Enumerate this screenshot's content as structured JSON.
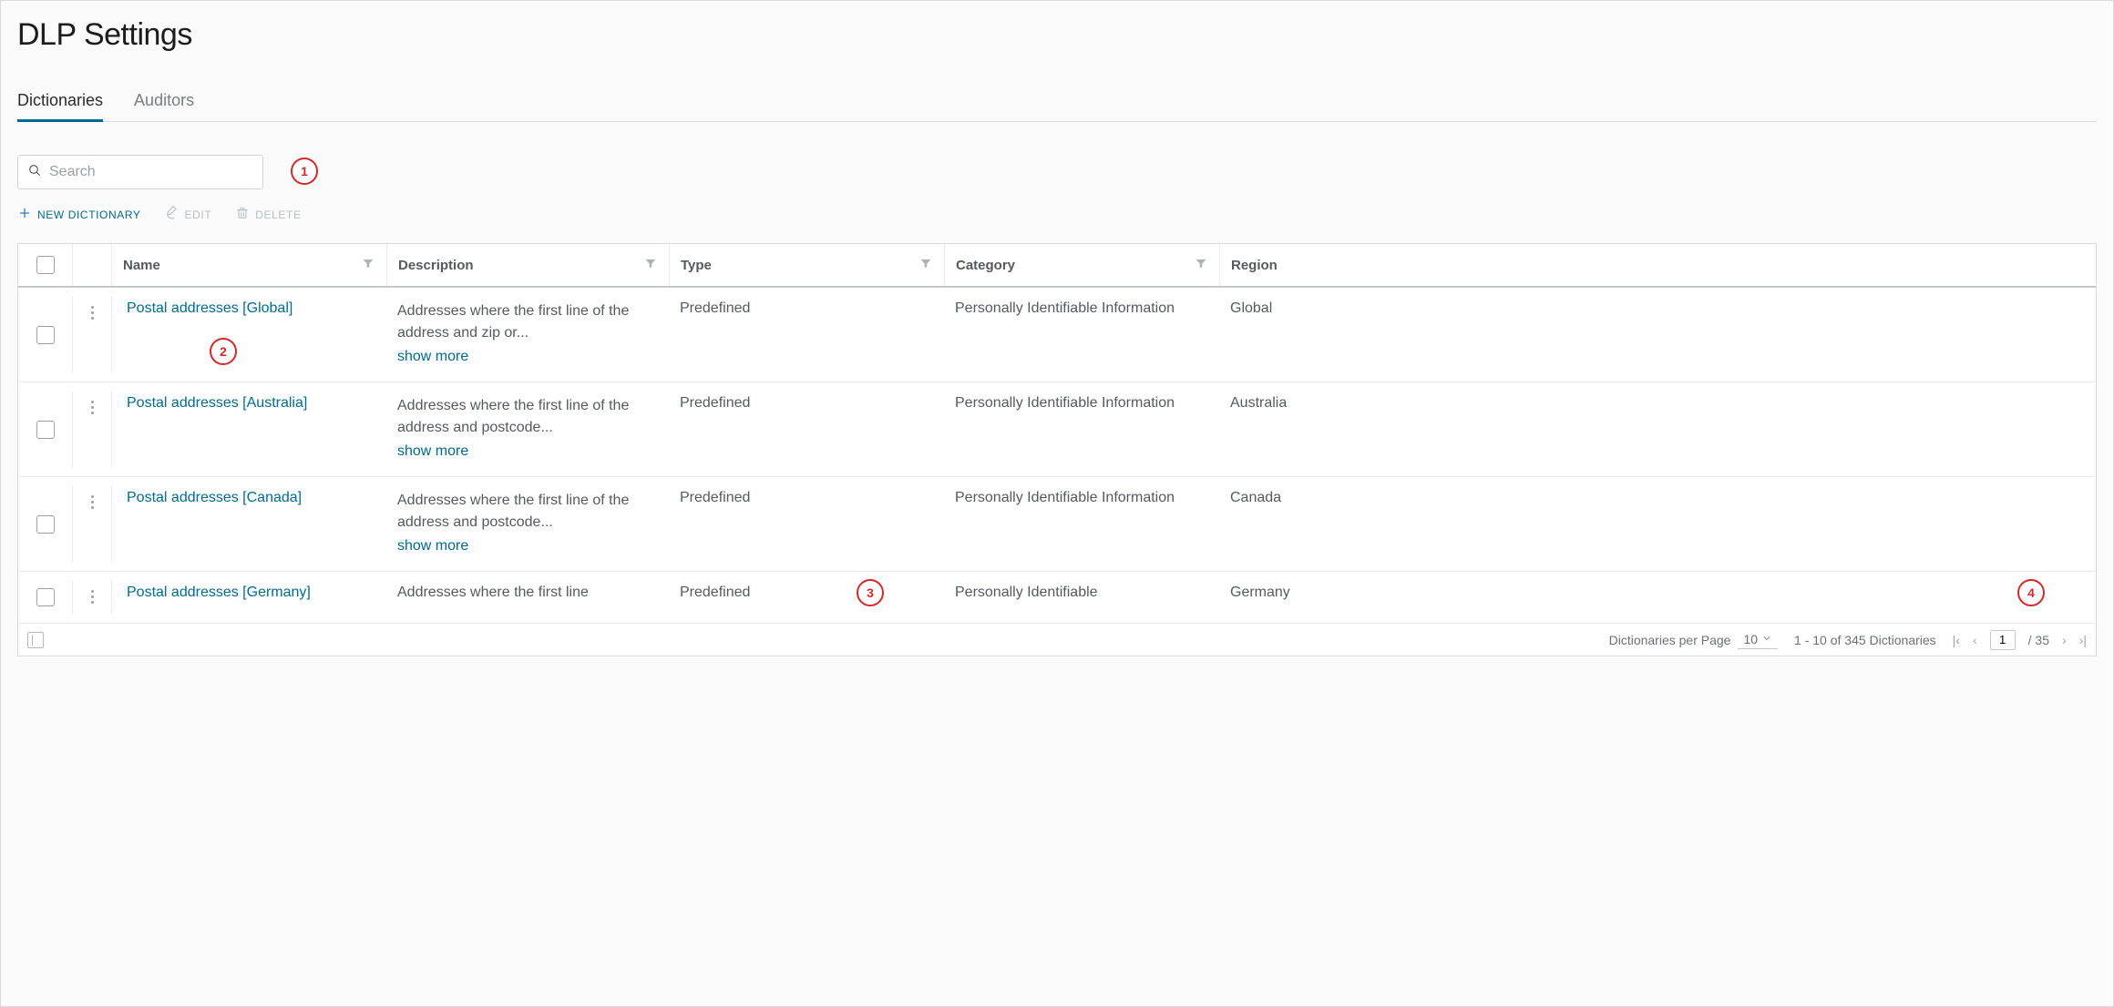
{
  "page_title": "DLP Settings",
  "tabs": [
    {
      "label": "Dictionaries",
      "active": true
    },
    {
      "label": "Auditors",
      "active": false
    }
  ],
  "search": {
    "placeholder": "Search"
  },
  "actions": {
    "new_label": "NEW DICTIONARY",
    "edit_label": "EDIT",
    "delete_label": "DELETE"
  },
  "columns": {
    "name": "Name",
    "description": "Description",
    "type": "Type",
    "category": "Category",
    "region": "Region"
  },
  "show_more_label": "show more",
  "rows": [
    {
      "name": "Postal addresses [Global]",
      "description": "Addresses where the first line of the address and zip or...",
      "type": "Predefined",
      "category": "Personally Identifiable Information",
      "region": "Global"
    },
    {
      "name": "Postal addresses [Australia]",
      "description": "Addresses where the first line of the address and postcode...",
      "type": "Predefined",
      "category": "Personally Identifiable Information",
      "region": "Australia"
    },
    {
      "name": "Postal addresses [Canada]",
      "description": "Addresses where the first line of the address and postcode...",
      "type": "Predefined",
      "category": "Personally Identifiable Information",
      "region": "Canada"
    },
    {
      "name": "Postal addresses [Germany]",
      "description": "Addresses where the first line",
      "type": "Predefined",
      "category": "Personally Identifiable",
      "region": "Germany"
    }
  ],
  "footer": {
    "perpage_label": "Dictionaries per Page",
    "perpage_value": "10",
    "range_label": "1 - 10 of 345 Dictionaries",
    "page_input": "1",
    "page_total": "/ 35"
  },
  "annotations": {
    "a1": "1",
    "a2": "2",
    "a3": "3",
    "a4": "4"
  }
}
